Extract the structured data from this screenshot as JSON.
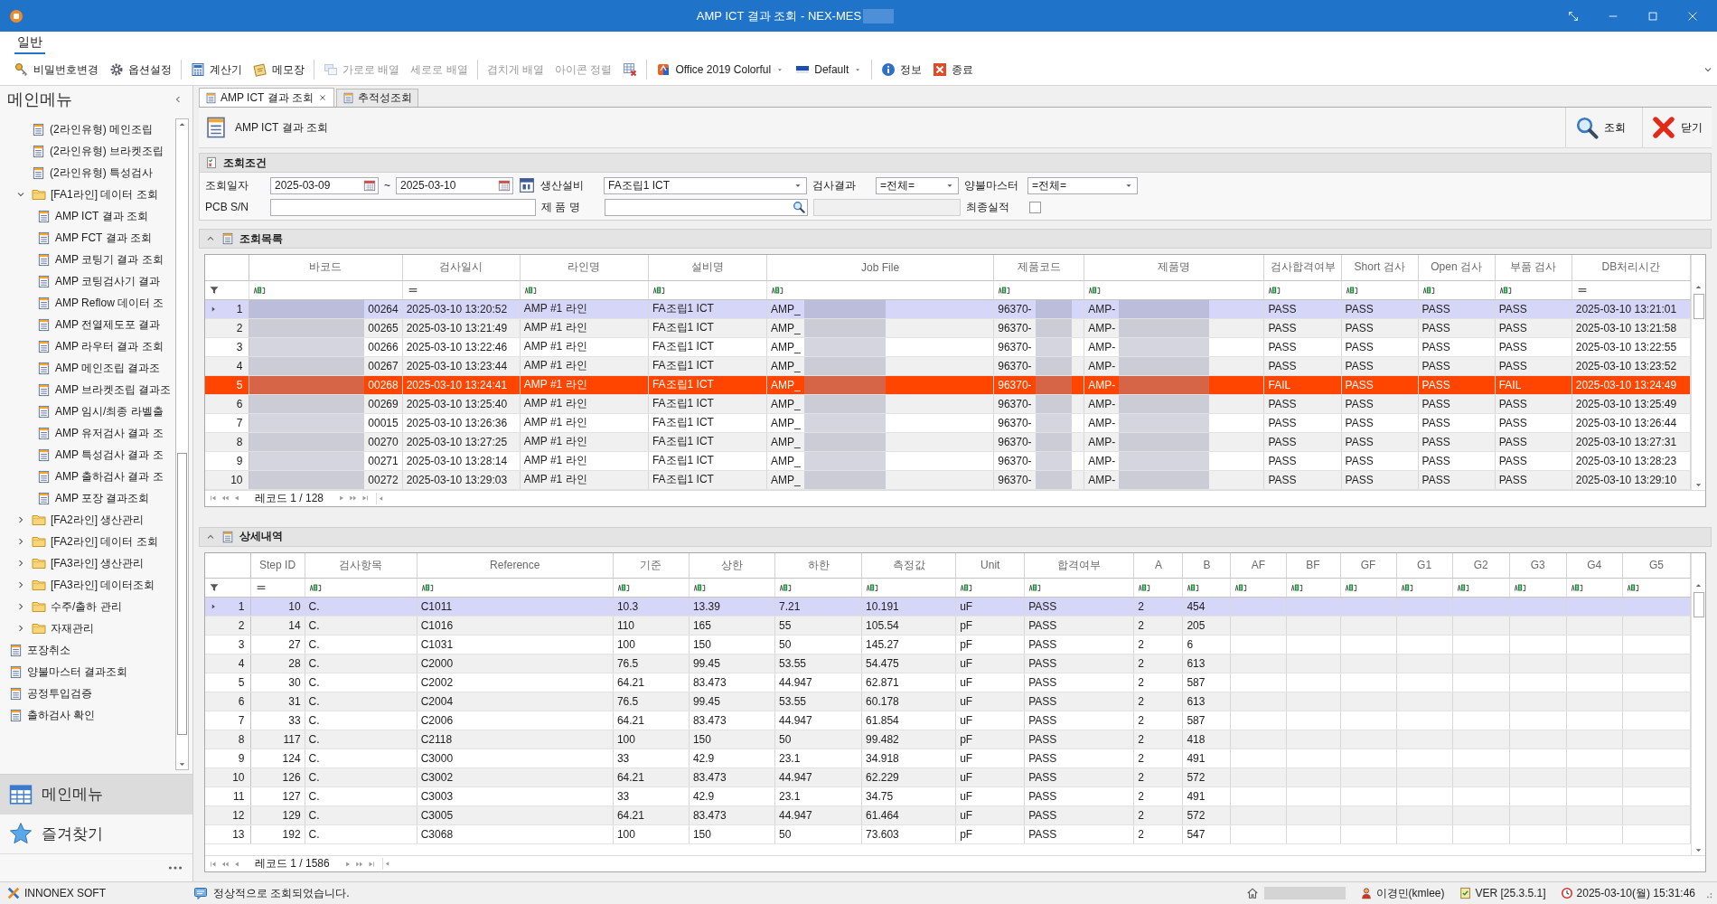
{
  "window": {
    "title": "AMP ICT 결과 조회 - NEX-MES"
  },
  "ribbon": {
    "tabs": [
      {
        "label": "일반",
        "selected": true
      }
    ],
    "toolbar_groups": [
      [
        {
          "kind": "key",
          "label": "비밀번호변경",
          "disabled": false
        },
        {
          "kind": "gear",
          "label": "옵션설정",
          "disabled": false
        }
      ],
      [
        {
          "kind": "calculator",
          "label": "계산기",
          "disabled": false
        },
        {
          "kind": "memo",
          "label": "메모장",
          "disabled": false
        }
      ],
      [
        {
          "kind": "tile",
          "label": "가로로 배열",
          "disabled": true
        },
        {
          "kind": "text",
          "label": "세로로 배열",
          "disabled": true
        }
      ],
      [
        {
          "kind": "text",
          "label": "겹치게 배열",
          "disabled": true
        },
        {
          "kind": "text",
          "label": "아이콘 정렬",
          "disabled": true
        },
        {
          "kind": "close-windows",
          "disabled": false
        }
      ],
      [
        {
          "kind": "theme",
          "label": "Office 2019 Colorful",
          "disabled": false,
          "has_menu": true
        },
        {
          "kind": "palette",
          "label": "Default",
          "disabled": false,
          "has_menu": true
        }
      ],
      [
        {
          "kind": "info",
          "label": "정보",
          "disabled": false
        },
        {
          "kind": "exit",
          "label": "종료",
          "disabled": false
        }
      ]
    ]
  },
  "sidebar": {
    "title": "메인메뉴",
    "tree": [
      {
        "label": "(2라인유형) 메인조립",
        "kind": "page"
      },
      {
        "label": "(2라인유형) 브라켓조립",
        "kind": "page"
      },
      {
        "label": "(2라인유형) 특성검사",
        "kind": "page"
      },
      {
        "label": "[FA1라인] 데이터 조회",
        "kind": "folder",
        "expanded": true,
        "children": [
          {
            "label": "AMP ICT 결과 조회",
            "kind": "page"
          },
          {
            "label": "AMP FCT 결과 조회",
            "kind": "page"
          },
          {
            "label": "AMP 코팅기 결과 조회",
            "kind": "page"
          },
          {
            "label": "AMP 코팅검사기 결과",
            "kind": "page"
          },
          {
            "label": "AMP Reflow 데이터 조",
            "kind": "page"
          },
          {
            "label": "AMP 전열제도포 결과",
            "kind": "page"
          },
          {
            "label": "AMP 라우터 결과 조회",
            "kind": "page"
          },
          {
            "label": "AMP 메인조립 결과조",
            "kind": "page"
          },
          {
            "label": "AMP 브라켓조립 결과조",
            "kind": "page"
          },
          {
            "label": "AMP 임시/최종 라벨출",
            "kind": "page"
          },
          {
            "label": "AMP 유저검사 결과 조",
            "kind": "page"
          },
          {
            "label": "AMP 특성검사 결과 조",
            "kind": "page"
          },
          {
            "label": "AMP 출하검사 결과 조",
            "kind": "page"
          },
          {
            "label": "AMP 포장 결과조회",
            "kind": "page"
          }
        ]
      },
      {
        "label": "[FA2라인] 생산관리",
        "kind": "folder",
        "expanded": false
      },
      {
        "label": "[FA2라인] 데이터 조회",
        "kind": "folder",
        "expanded": false
      },
      {
        "label": "[FA3라인] 생산관리",
        "kind": "folder",
        "expanded": false
      },
      {
        "label": "[FA3라인] 데이터조회",
        "kind": "folder",
        "expanded": false
      },
      {
        "label": "수주/출하 관리",
        "kind": "folder",
        "expanded": false
      },
      {
        "label": "자재관리",
        "kind": "folder",
        "expanded": false
      }
    ],
    "root_items": [
      {
        "label": "포장취소",
        "kind": "page"
      },
      {
        "label": "양불마스터 결과조회",
        "kind": "page"
      },
      {
        "label": "공정투입검증",
        "kind": "page"
      },
      {
        "label": "출하검사 확인",
        "kind": "page"
      }
    ],
    "nav": [
      {
        "label": "메인메뉴",
        "kind": "grid",
        "selected": true
      },
      {
        "label": "즐겨찾기",
        "kind": "star",
        "selected": false
      }
    ]
  },
  "doc_tabs": [
    {
      "label": "AMP ICT 결과 조회",
      "selected": true,
      "closable": true
    },
    {
      "label": "추적성조회",
      "selected": false,
      "closable": false
    }
  ],
  "panel": {
    "title": "AMP ICT 결과 조회",
    "actions": [
      {
        "kind": "search",
        "label": "조회"
      },
      {
        "kind": "close",
        "label": "닫기"
      }
    ]
  },
  "query": {
    "title": "조회조건",
    "date_label": "조회일자",
    "date_from": "2025-03-09",
    "date_sep": "~",
    "date_to": "2025-03-10",
    "equipment_label": "생산설비",
    "equipment": "FA조립1 ICT",
    "result_label": "검사결과",
    "result": "=전체=",
    "master_label": "양불마스터",
    "master": "=전체=",
    "pcb_label": "PCB S/N",
    "product_label": "제 품 명",
    "extra_field": {
      "disabled": true
    },
    "final_label": "최종실적",
    "final_checked": false
  },
  "result_list": {
    "title": "조회목록",
    "expanded": true,
    "columns": [
      {
        "label": "바코드",
        "kind": "text",
        "redacted": true
      },
      {
        "label": "검사일시",
        "kind": "equals"
      },
      {
        "label": "라인명",
        "kind": "text"
      },
      {
        "label": "설비명",
        "kind": "text"
      },
      {
        "label": "Job File",
        "kind": "text",
        "redacted": true
      },
      {
        "label": "제품코드",
        "kind": "text",
        "redacted": true
      },
      {
        "label": "제품명",
        "kind": "text",
        "redacted": true
      },
      {
        "label": "검사합격여부",
        "kind": "text"
      },
      {
        "label": "Short 검사",
        "kind": "text"
      },
      {
        "label": "Open 검사",
        "kind": "text"
      },
      {
        "label": "부품 검사",
        "kind": "text"
      },
      {
        "label": "DB처리시간",
        "kind": "equals"
      }
    ],
    "rows": [
      {
        "no": "1",
        "selected": true,
        "failed": false,
        "cells": [
          "00264",
          "2025-03-10 13:20:52",
          "AMP #1 라인",
          "FA조립1 ICT",
          "AMP_",
          "96370-",
          "AMP-",
          "PASS",
          "PASS",
          "PASS",
          "PASS",
          "2025-03-10 13:21:01"
        ]
      },
      {
        "no": "2",
        "selected": false,
        "failed": false,
        "cells": [
          "00265",
          "2025-03-10 13:21:49",
          "AMP #1 라인",
          "FA조립1 ICT",
          "AMP_",
          "96370-",
          "AMP-",
          "PASS",
          "PASS",
          "PASS",
          "PASS",
          "2025-03-10 13:21:58"
        ]
      },
      {
        "no": "3",
        "selected": false,
        "failed": false,
        "cells": [
          "00266",
          "2025-03-10 13:22:46",
          "AMP #1 라인",
          "FA조립1 ICT",
          "AMP_",
          "96370-",
          "AMP-",
          "PASS",
          "PASS",
          "PASS",
          "PASS",
          "2025-03-10 13:22:55"
        ]
      },
      {
        "no": "4",
        "selected": false,
        "failed": false,
        "cells": [
          "00267",
          "2025-03-10 13:23:44",
          "AMP #1 라인",
          "FA조립1 ICT",
          "AMP_",
          "96370-",
          "AMP-",
          "PASS",
          "PASS",
          "PASS",
          "PASS",
          "2025-03-10 13:23:52"
        ]
      },
      {
        "no": "5",
        "selected": false,
        "failed": true,
        "cells": [
          "00268",
          "2025-03-10 13:24:41",
          "AMP #1 라인",
          "FA조립1 ICT",
          "AMP_",
          "96370-",
          "AMP-",
          "FAIL",
          "PASS",
          "PASS",
          "FAIL",
          "2025-03-10 13:24:49"
        ]
      },
      {
        "no": "6",
        "selected": false,
        "failed": false,
        "cells": [
          "00269",
          "2025-03-10 13:25:40",
          "AMP #1 라인",
          "FA조립1 ICT",
          "AMP_",
          "96370-",
          "AMP-",
          "PASS",
          "PASS",
          "PASS",
          "PASS",
          "2025-03-10 13:25:49"
        ]
      },
      {
        "no": "7",
        "selected": false,
        "failed": false,
        "cells": [
          "00015",
          "2025-03-10 13:26:36",
          "AMP #1 라인",
          "FA조립1 ICT",
          "AMP_",
          "96370-",
          "AMP-",
          "PASS",
          "PASS",
          "PASS",
          "PASS",
          "2025-03-10 13:26:44"
        ]
      },
      {
        "no": "8",
        "selected": false,
        "failed": false,
        "cells": [
          "00270",
          "2025-03-10 13:27:25",
          "AMP #1 라인",
          "FA조립1 ICT",
          "AMP_",
          "96370-",
          "AMP-",
          "PASS",
          "PASS",
          "PASS",
          "PASS",
          "2025-03-10 13:27:31"
        ]
      },
      {
        "no": "9",
        "selected": false,
        "failed": false,
        "cells": [
          "00271",
          "2025-03-10 13:28:14",
          "AMP #1 라인",
          "FA조립1 ICT",
          "AMP_",
          "96370-",
          "AMP-",
          "PASS",
          "PASS",
          "PASS",
          "PASS",
          "2025-03-10 13:28:23"
        ]
      },
      {
        "no": "10",
        "selected": false,
        "failed": false,
        "cells": [
          "00272",
          "2025-03-10 13:29:03",
          "AMP #1 라인",
          "FA조립1 ICT",
          "AMP_",
          "96370-",
          "AMP-",
          "PASS",
          "PASS",
          "PASS",
          "PASS",
          "2025-03-10 13:29:10"
        ]
      }
    ],
    "navigator": "레코드 1 / 128"
  },
  "detail": {
    "title": "상세내역",
    "expanded": true,
    "columns": [
      {
        "label": "Step ID",
        "kind": "equals"
      },
      {
        "label": "검사항목",
        "kind": "text"
      },
      {
        "label": "Reference",
        "kind": "text"
      },
      {
        "label": "기준",
        "kind": "text"
      },
      {
        "label": "상한",
        "kind": "text"
      },
      {
        "label": "하한",
        "kind": "text"
      },
      {
        "label": "측정값",
        "kind": "text"
      },
      {
        "label": "Unit",
        "kind": "text"
      },
      {
        "label": "합격여부",
        "kind": "text"
      },
      {
        "label": "A",
        "kind": "text"
      },
      {
        "label": "B",
        "kind": "text"
      },
      {
        "label": "AF",
        "kind": "text"
      },
      {
        "label": "BF",
        "kind": "text"
      },
      {
        "label": "GF",
        "kind": "text"
      },
      {
        "label": "G1",
        "kind": "text"
      },
      {
        "label": "G2",
        "kind": "text"
      },
      {
        "label": "G3",
        "kind": "text"
      },
      {
        "label": "G4",
        "kind": "text"
      },
      {
        "label": "G5",
        "kind": "text"
      }
    ],
    "rows": [
      {
        "no": "1",
        "selected": true,
        "cells": [
          "10",
          "C.",
          "C1011",
          "10.3",
          "13.39",
          "7.21",
          "10.191",
          "uF",
          "PASS",
          "2",
          "454"
        ]
      },
      {
        "no": "2",
        "selected": false,
        "cells": [
          "14",
          "C.",
          "C1016",
          "110",
          "165",
          "55",
          "105.54",
          "pF",
          "PASS",
          "2",
          "205"
        ]
      },
      {
        "no": "3",
        "selected": false,
        "cells": [
          "27",
          "C.",
          "C1031",
          "100",
          "150",
          "50",
          "145.27",
          "pF",
          "PASS",
          "2",
          "6"
        ]
      },
      {
        "no": "4",
        "selected": false,
        "cells": [
          "28",
          "C.",
          "C2000",
          "76.5",
          "99.45",
          "53.55",
          "54.475",
          "uF",
          "PASS",
          "2",
          "613"
        ]
      },
      {
        "no": "5",
        "selected": false,
        "cells": [
          "30",
          "C.",
          "C2002",
          "64.21",
          "83.473",
          "44.947",
          "62.871",
          "uF",
          "PASS",
          "2",
          "587"
        ]
      },
      {
        "no": "6",
        "selected": false,
        "cells": [
          "31",
          "C.",
          "C2004",
          "76.5",
          "99.45",
          "53.55",
          "60.178",
          "uF",
          "PASS",
          "2",
          "613"
        ]
      },
      {
        "no": "7",
        "selected": false,
        "cells": [
          "33",
          "C.",
          "C2006",
          "64.21",
          "83.473",
          "44.947",
          "61.854",
          "uF",
          "PASS",
          "2",
          "587"
        ]
      },
      {
        "no": "8",
        "selected": false,
        "cells": [
          "117",
          "C.",
          "C2118",
          "100",
          "150",
          "50",
          "99.482",
          "pF",
          "PASS",
          "2",
          "418"
        ]
      },
      {
        "no": "9",
        "selected": false,
        "cells": [
          "124",
          "C.",
          "C3000",
          "33",
          "42.9",
          "23.1",
          "34.918",
          "uF",
          "PASS",
          "2",
          "491"
        ]
      },
      {
        "no": "10",
        "selected": false,
        "cells": [
          "126",
          "C.",
          "C3002",
          "64.21",
          "83.473",
          "44.947",
          "62.229",
          "uF",
          "PASS",
          "2",
          "572"
        ]
      },
      {
        "no": "11",
        "selected": false,
        "cells": [
          "127",
          "C.",
          "C3003",
          "33",
          "42.9",
          "23.1",
          "34.75",
          "uF",
          "PASS",
          "2",
          "491"
        ]
      },
      {
        "no": "12",
        "selected": false,
        "cells": [
          "129",
          "C.",
          "C3005",
          "64.21",
          "83.473",
          "44.947",
          "61.464",
          "uF",
          "PASS",
          "2",
          "572"
        ]
      },
      {
        "no": "13",
        "selected": false,
        "cells": [
          "192",
          "C.",
          "C3068",
          "100",
          "150",
          "50",
          "73.603",
          "pF",
          "PASS",
          "2",
          "547"
        ]
      }
    ],
    "navigator": "레코드 1 / 1586"
  },
  "status_bar": {
    "company": "INNONEX SOFT",
    "message": "정상적으로 조회되었습니다.",
    "user": "이경민(kmlee)",
    "version": "VER [25.3.5.1]",
    "datetime": "2025-03-10(월) 15:31:46"
  }
}
